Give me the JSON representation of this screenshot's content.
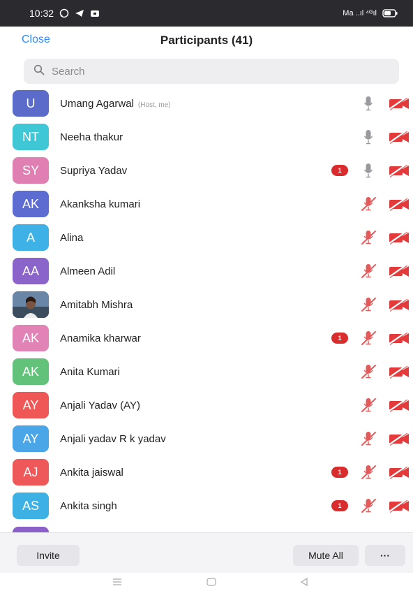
{
  "status_bar": {
    "time": "10:32",
    "signal_text": "Ma ..ıl ⁴ᴳıl"
  },
  "header": {
    "close_label": "Close",
    "title": "Participants (41)"
  },
  "search": {
    "placeholder": "Search"
  },
  "colors": {
    "accent": "#2d8cff",
    "muted_red": "#d92c2c",
    "badge": "#d92c2c"
  },
  "participants": [
    {
      "initials": "U",
      "name": "Umang Agarwal",
      "tag": "(Host, me)",
      "avatar_color": "#5a6bc9",
      "badge": "",
      "mic": "mic-on-icon",
      "cam": "video-off-icon"
    },
    {
      "initials": "NT",
      "name": "Neeha thakur",
      "tag": "",
      "avatar_color": "#3fc7d6",
      "badge": "",
      "mic": "mic-on-icon",
      "cam": "video-off-icon"
    },
    {
      "initials": "SY",
      "name": "Supriya Yadav",
      "tag": "",
      "avatar_color": "#e07fb2",
      "badge": "1",
      "mic": "mic-on-icon",
      "cam": "video-off-icon"
    },
    {
      "initials": "AK",
      "name": "Akanksha kumari",
      "tag": "",
      "avatar_color": "#5c6cd0",
      "badge": "",
      "mic": "mic-muted-icon",
      "cam": "video-off-icon"
    },
    {
      "initials": "A",
      "name": "Alina",
      "tag": "",
      "avatar_color": "#3eb1e6",
      "badge": "",
      "mic": "mic-muted-icon",
      "cam": "video-off-icon"
    },
    {
      "initials": "AA",
      "name": "Almeen Adil",
      "tag": "",
      "avatar_color": "#8a64c9",
      "badge": "",
      "mic": "mic-muted-icon",
      "cam": "video-off-icon"
    },
    {
      "initials": "",
      "name": "Amitabh Mishra",
      "tag": "",
      "avatar_color": "#4b6c8c",
      "badge": "",
      "mic": "mic-muted-icon",
      "cam": "video-off-icon",
      "photo": true
    },
    {
      "initials": "AK",
      "name": "Anamika kharwar",
      "tag": "",
      "avatar_color": "#e283b6",
      "badge": "1",
      "mic": "mic-muted-icon",
      "cam": "video-off-icon"
    },
    {
      "initials": "AK",
      "name": "Anita Kumari",
      "tag": "",
      "avatar_color": "#62c27a",
      "badge": "",
      "mic": "mic-muted-icon",
      "cam": "video-off-icon"
    },
    {
      "initials": "AY",
      "name": "Anjali Yadav (AY)",
      "tag": "",
      "avatar_color": "#ef5656",
      "badge": "",
      "mic": "mic-muted-icon",
      "cam": "video-off-icon"
    },
    {
      "initials": "AY",
      "name": "Anjali yadav R k yadav",
      "tag": "",
      "avatar_color": "#4ba6e8",
      "badge": "",
      "mic": "mic-muted-icon",
      "cam": "video-off-icon"
    },
    {
      "initials": "AJ",
      "name": "Ankita jaiswal",
      "tag": "",
      "avatar_color": "#ef5858",
      "badge": "1",
      "mic": "mic-muted-icon",
      "cam": "video-off-icon"
    },
    {
      "initials": "AS",
      "name": "Ankita singh",
      "tag": "",
      "avatar_color": "#3db1e3",
      "badge": "1",
      "mic": "mic-muted-icon",
      "cam": "video-off-icon"
    }
  ],
  "footer": {
    "invite_label": "Invite",
    "mute_all_label": "Mute All",
    "more_label": "···"
  }
}
